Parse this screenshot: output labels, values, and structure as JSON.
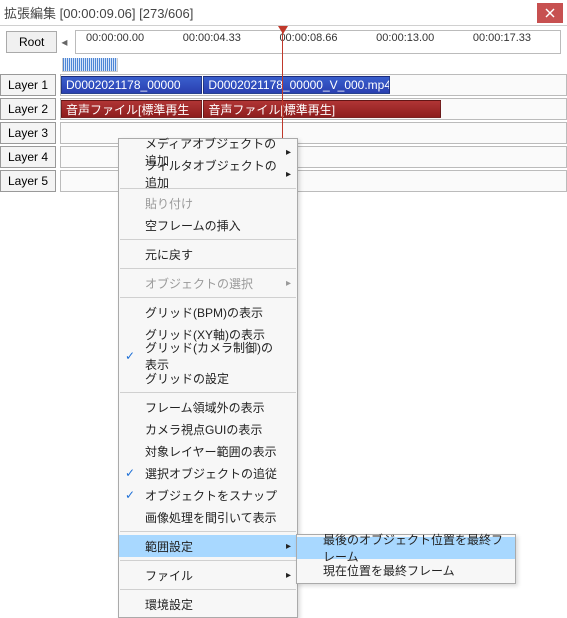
{
  "window": {
    "title": "拡張編集 [00:00:09.06] [273/606]"
  },
  "toolbar": {
    "root": "Root"
  },
  "ruler": {
    "ticks": [
      "00:00:00.00",
      "00:00:04.33",
      "00:00:08.66",
      "00:00:13.00",
      "00:00:17.33"
    ]
  },
  "layers": {
    "l1": "Layer 1",
    "l2": "Layer 2",
    "l3": "Layer 3",
    "l4": "Layer 4",
    "l5": "Layer 5"
  },
  "clips": {
    "c1a": "D0002021178_00000",
    "c1b": "D0002021178_00000_V_000.mp4",
    "c2a": "音声ファイル[標準再生",
    "c2b": "音声ファイル[標準再生]"
  },
  "menu": {
    "add_media": "メディアオブジェクトの追加",
    "add_filter": "フィルタオブジェクトの追加",
    "paste": "貼り付け",
    "insert_empty": "空フレームの挿入",
    "undo": "元に戻す",
    "select_obj": "オブジェクトの選択",
    "grid_bpm": "グリッド(BPM)の表示",
    "grid_xy": "グリッド(XY軸)の表示",
    "grid_cam": "グリッド(カメラ制御)の表示",
    "grid_cfg": "グリッドの設定",
    "frm_outside": "フレーム領域外の表示",
    "cam_gui": "カメラ視点GUIの表示",
    "layer_range": "対象レイヤー範囲の表示",
    "follow_sel": "選択オブジェクトの追従",
    "snap_obj": "オブジェクトをスナップ",
    "thin_img": "画像処理を間引いて表示",
    "range_cfg": "範囲設定",
    "file": "ファイル",
    "env": "環境設定"
  },
  "submenu": {
    "last_obj": "最後のオブジェクト位置を最終フレーム",
    "cur_pos": "現在位置を最終フレーム"
  }
}
